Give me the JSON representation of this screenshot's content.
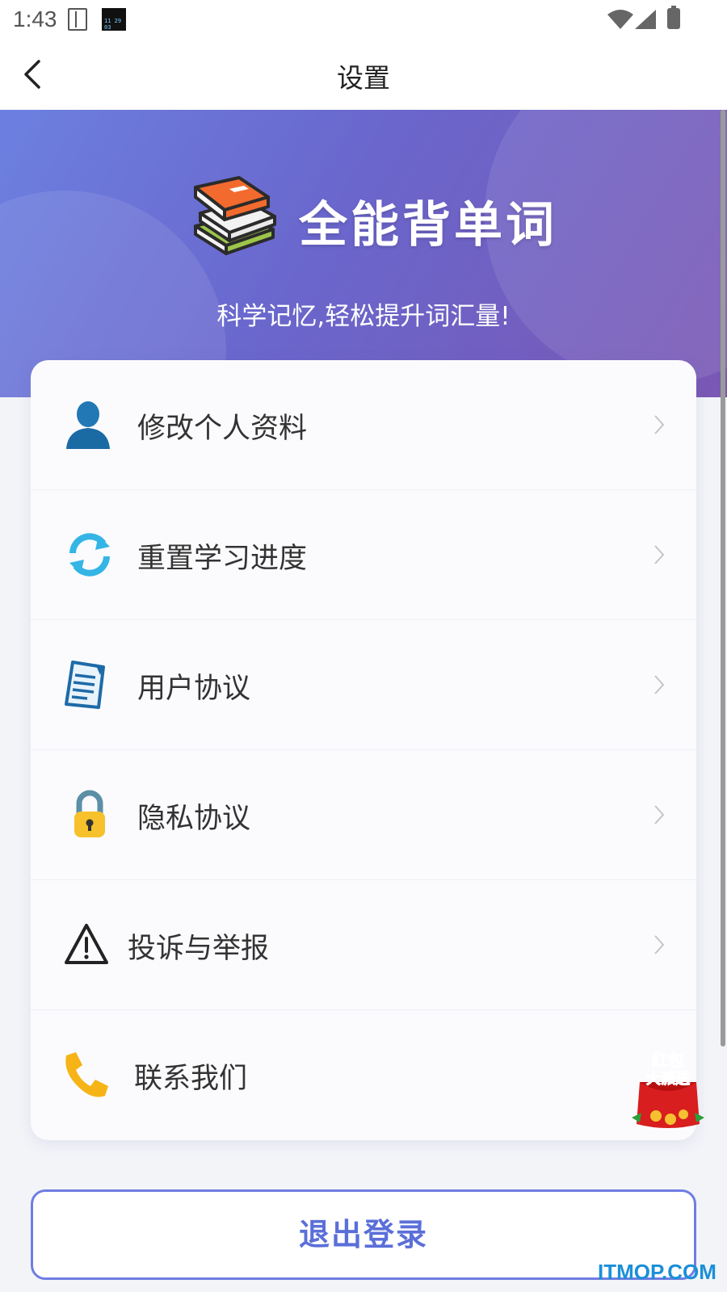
{
  "status_bar": {
    "time": "1:43",
    "clock_widget": "11 29 03"
  },
  "nav": {
    "title": "设置"
  },
  "header": {
    "app_name": "全能背单词",
    "slogan": "科学记忆,轻松提升词汇量!"
  },
  "menu": [
    {
      "label": "修改个人资料",
      "icon": "user-icon"
    },
    {
      "label": "重置学习进度",
      "icon": "refresh-icon"
    },
    {
      "label": "用户协议",
      "icon": "document-icon"
    },
    {
      "label": "隐私协议",
      "icon": "lock-icon"
    },
    {
      "label": "投诉与举报",
      "icon": "warning-icon"
    },
    {
      "label": "联系我们",
      "icon": "phone-icon"
    }
  ],
  "promo": {
    "line1": "红包",
    "line2": "大派送"
  },
  "logout": {
    "label": "退出登录"
  },
  "watermark": "ITMOP.COM",
  "colors": {
    "accent": "#5b6fd9",
    "banner_start": "#6c80e0",
    "banner_end": "#7a58b4"
  }
}
